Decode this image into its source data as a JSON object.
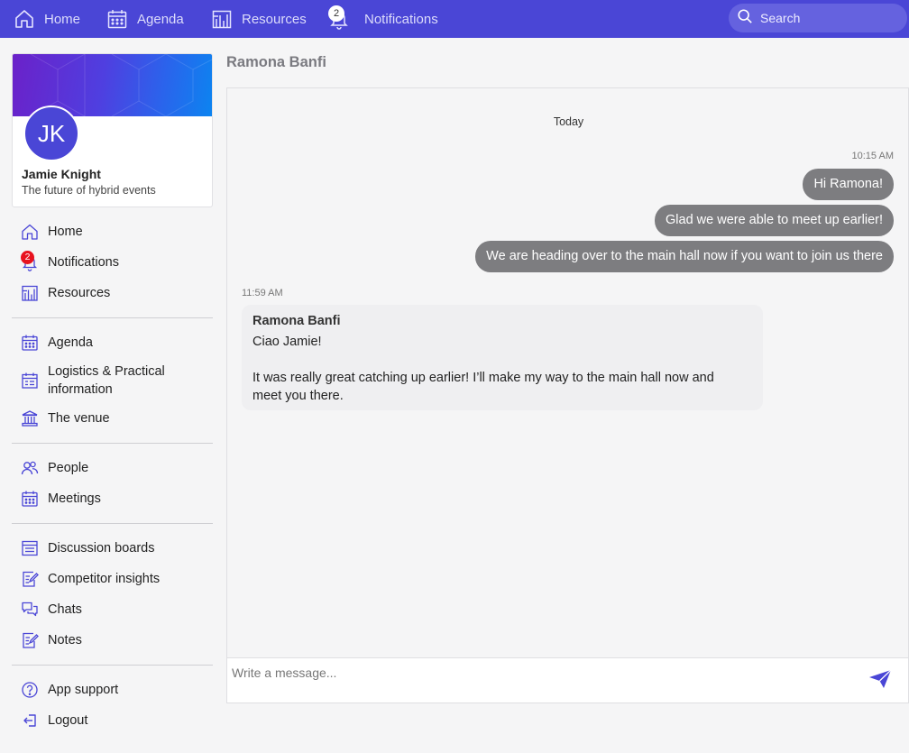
{
  "topnav": {
    "home_label": "Home",
    "agenda_label": "Agenda",
    "resources_label": "Resources",
    "notifications_label": "Notifications",
    "notifications_count": "2",
    "search_placeholder": "Search"
  },
  "profile": {
    "initials": "JK",
    "name": "Jamie Knight",
    "tagline": "The future of hybrid events"
  },
  "sidebar": {
    "items": [
      {
        "label": "Home",
        "icon": "home-icon"
      },
      {
        "label": "Notifications",
        "icon": "bell-icon",
        "badge": "2"
      },
      {
        "label": "Resources",
        "icon": "resources-icon"
      },
      {
        "label": "Agenda",
        "icon": "calendar-icon"
      },
      {
        "label": "Logistics & Practical",
        "label2": "information",
        "icon": "logistics-icon"
      },
      {
        "label": "The venue",
        "icon": "venue-icon"
      },
      {
        "label": "People",
        "icon": "people-icon"
      },
      {
        "label": "Meetings",
        "icon": "calendar-icon"
      },
      {
        "label": "Discussion boards",
        "icon": "board-icon"
      },
      {
        "label": "Competitor insights",
        "icon": "edit-note-icon"
      },
      {
        "label": "Chats",
        "icon": "chat-icon"
      },
      {
        "label": "Notes",
        "icon": "notes-icon"
      },
      {
        "label": "App support",
        "icon": "help-icon"
      },
      {
        "label": "Logout",
        "icon": "logout-icon"
      }
    ]
  },
  "chat": {
    "title": "Ramona Banfi",
    "day_label": "Today",
    "outgoing_time": "10:15 AM",
    "outgoing": [
      "Hi Ramona!",
      "Glad we were able to meet up earlier!",
      "We are heading over to the main hall now if you want to join us there"
    ],
    "incoming_time": "11:59 AM",
    "incoming": {
      "sender": "Ramona Banfi",
      "line1": "Ciao Jamie!",
      "line2": "It was really great catching up earlier! I’ll make my way to the main hall now and",
      "line3": "meet you there."
    },
    "composer_placeholder": "Write a message..."
  },
  "colors": {
    "brand": "#4a46d6",
    "bubble": "#7d7d80",
    "badge": "#e8121e"
  }
}
